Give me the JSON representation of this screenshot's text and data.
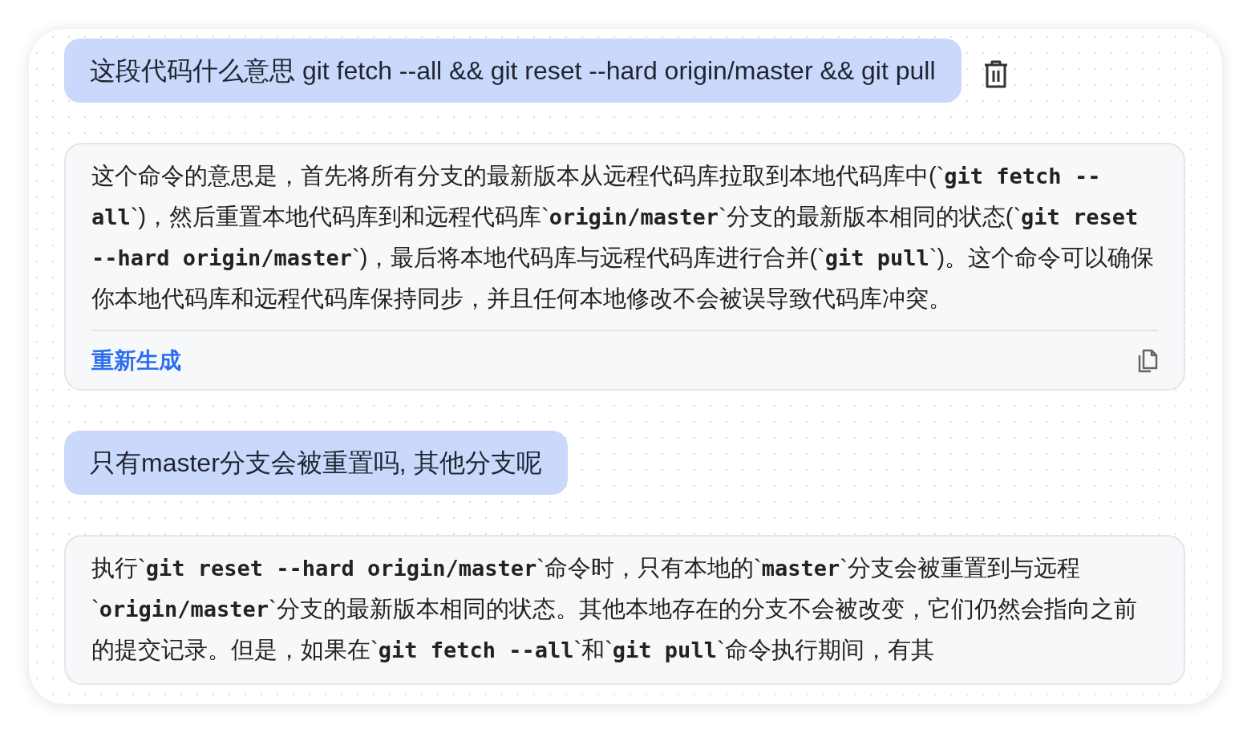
{
  "messages": [
    {
      "kind": "user",
      "text": "这段代码什么意思 git fetch --all && git reset --hard origin/master && git pull",
      "show_delete": true
    },
    {
      "kind": "assistant",
      "text": "这个命令的意思是，首先将所有分支的最新版本从远程代码库拉取到本地代码库中(`**git fetch --all**`)，然后重置本地代码库到和远程代码库`**origin/master**`分支的最新版本相同的状态(`**git reset --hard origin/master**`)，最后将本地代码库与远程代码库进行合并(`**git pull**`)。这个命令可以确保你本地代码库和远程代码库保持同步，并且任何本地修改不会被误导致代码库冲突。",
      "regenerate": "重新生成",
      "show_copy": true
    },
    {
      "kind": "user",
      "text": "只有master分支会被重置吗, 其他分支呢",
      "show_delete": false
    },
    {
      "kind": "assistant",
      "text": "执行`**git reset --hard origin/master**`命令时，只有本地的`**master**`分支会被重置到与远程`**origin/master**`分支的最新版本相同的状态。其他本地存在的分支不会被改变，它们仍然会指向之前的提交记录。但是，如果在`**git fetch --all**`和`**git pull**`命令执行期间，有其",
      "show_copy": false
    }
  ]
}
